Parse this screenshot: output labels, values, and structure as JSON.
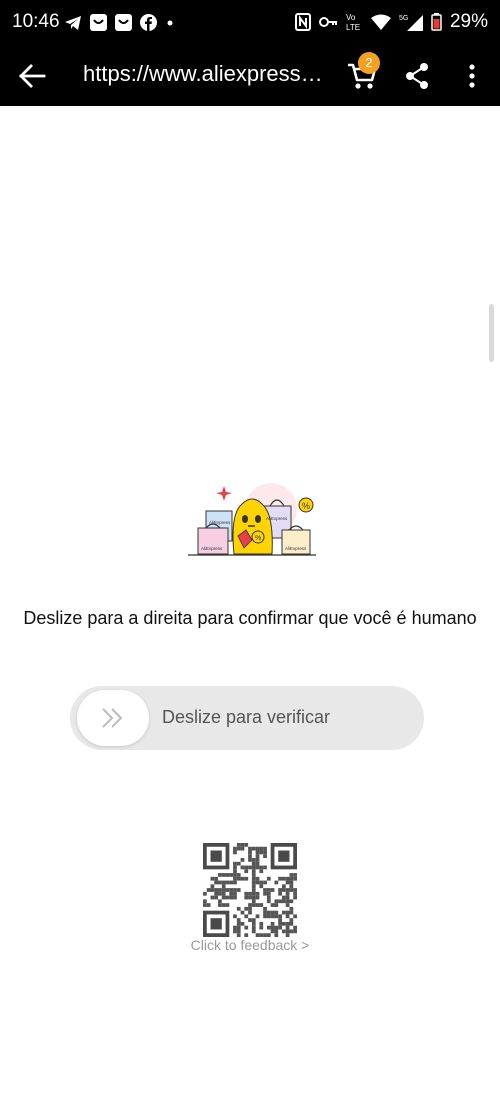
{
  "status_bar": {
    "time": "10:46",
    "battery": "29%",
    "network": "5G",
    "volte": "Vo LTE",
    "left_icons": [
      "telegram-icon",
      "aliexpress-icon",
      "aliexpress-icon",
      "facebook-icon",
      "dot-icon"
    ],
    "right_icons": [
      "nfc-icon",
      "key-icon",
      "volte-icon",
      "wifi-icon",
      "signal-icon",
      "battery-icon"
    ]
  },
  "toolbar": {
    "url": "https://www.aliexpress.com",
    "cart_count": "2",
    "background_color": "#000000",
    "badge_color": "#f5a020"
  },
  "captcha": {
    "illustration_label": "AliExpress",
    "instruction": "Deslize para a direita para confirmar que você é humano",
    "slider_label": "Deslize para verificar",
    "feedback_link": "Click to feedback >"
  }
}
